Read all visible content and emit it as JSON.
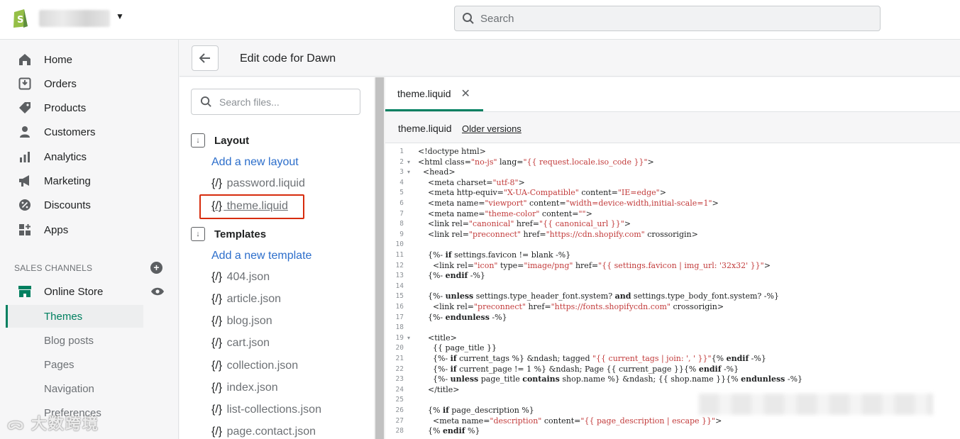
{
  "topbar": {
    "search_placeholder": "Search"
  },
  "nav": {
    "items": [
      {
        "label": "Home",
        "icon": "home-icon"
      },
      {
        "label": "Orders",
        "icon": "orders-icon"
      },
      {
        "label": "Products",
        "icon": "tag-icon"
      },
      {
        "label": "Customers",
        "icon": "person-icon"
      },
      {
        "label": "Analytics",
        "icon": "bar-chart-icon"
      },
      {
        "label": "Marketing",
        "icon": "megaphone-icon"
      },
      {
        "label": "Discounts",
        "icon": "discount-icon"
      },
      {
        "label": "Apps",
        "icon": "apps-icon"
      }
    ],
    "sales_channels_title": "SALES CHANNELS",
    "online_store": "Online Store",
    "sub_items": [
      "Themes",
      "Blog posts",
      "Pages",
      "Navigation",
      "Preferences"
    ]
  },
  "header": {
    "title": "Edit code for Dawn"
  },
  "files": {
    "search_placeholder": "Search files...",
    "layout_folder": "Layout",
    "add_layout": "Add a new layout",
    "layout_files": [
      "password.liquid",
      "theme.liquid"
    ],
    "templates_folder": "Templates",
    "add_template": "Add a new template",
    "template_files": [
      "404.json",
      "article.json",
      "blog.json",
      "cart.json",
      "collection.json",
      "index.json",
      "list-collections.json",
      "page.contact.json"
    ]
  },
  "editor": {
    "tab_label": "theme.liquid",
    "file_name": "theme.liquid",
    "older_versions": "Older versions",
    "lines": [
      "<!doctype html>",
      "<html class=\"no-js\" lang=\"{{ request.locale.iso_code }}\">",
      "  <head>",
      "    <meta charset=\"utf-8\">",
      "    <meta http-equiv=\"X-UA-Compatible\" content=\"IE=edge\">",
      "    <meta name=\"viewport\" content=\"width=device-width,initial-scale=1\">",
      "    <meta name=\"theme-color\" content=\"\">",
      "    <link rel=\"canonical\" href=\"{{ canonical_url }}\">",
      "    <link rel=\"preconnect\" href=\"https://cdn.shopify.com\" crossorigin>",
      "",
      "    {%- if settings.favicon != blank -%}",
      "      <link rel=\"icon\" type=\"image/png\" href=\"{{ settings.favicon | img_url: '32x32' }}\">",
      "    {%- endif -%}",
      "",
      "    {%- unless settings.type_header_font.system? and settings.type_body_font.system? -%}",
      "      <link rel=\"preconnect\" href=\"https://fonts.shopifycdn.com\" crossorigin>",
      "    {%- endunless -%}",
      "",
      "    <title>",
      "      {{ page_title }}",
      "      {%- if current_tags %} &ndash; tagged \"{{ current_tags | join: ', ' }}\"{% endif -%}",
      "      {%- if current_page != 1 %} &ndash; Page {{ current_page }}{% endif -%}",
      "      {%- unless page_title contains shop.name %} &ndash; {{ shop.name }}{% endunless -%}",
      "    </title>",
      "",
      "    {% if page_description %}",
      "      <meta name=\"description\" content=\"{{ page_description | escape }}\">",
      "    {% endif %}"
    ]
  },
  "watermark": "大数跨境"
}
